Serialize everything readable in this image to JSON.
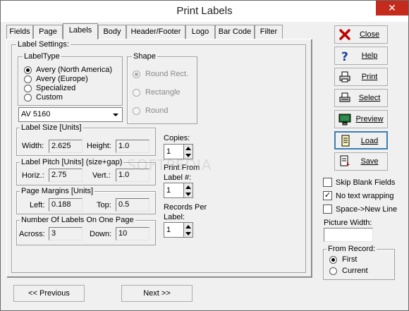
{
  "window": {
    "title": "Print Labels",
    "close_glyph": "✕"
  },
  "tabs": [
    "Fields",
    "Page",
    "Labels",
    "Body",
    "Header/Footer",
    "Logo",
    "Bar Code",
    "Filter"
  ],
  "active_tab": "Labels",
  "label_settings": {
    "legend": "Label Settings:",
    "label_type": {
      "legend": "LabelType",
      "options": [
        "Avery (North America)",
        "Avery (Europe)",
        "Specialized",
        "Custom"
      ],
      "selected": "Avery (North America)"
    },
    "shape": {
      "legend": "Shape",
      "options": [
        "Round Rect.",
        "Rectangle",
        "Round"
      ],
      "selected": "Round Rect."
    },
    "template": "AV 5160"
  },
  "label_size": {
    "legend": "Label Size [Units]",
    "width_label": "Width:",
    "width": "2.625",
    "height_label": "Height:",
    "height": "1.0"
  },
  "label_pitch": {
    "legend": "Label Pitch [Units] (size+gap)",
    "horiz_label": "Horiz.:",
    "horiz": "2.75",
    "vert_label": "Vert.:",
    "vert": "1.0"
  },
  "page_margins": {
    "legend": "Page Margins [Units]",
    "left_label": "Left:",
    "left": "0.188",
    "top_label": "Top:",
    "top": "0.5"
  },
  "labels_on_page": {
    "legend": "Number Of Labels On One Page",
    "across_label": "Across:",
    "across": "3",
    "down_label": "Down:",
    "down": "10"
  },
  "copies": {
    "label": "Copies:",
    "value": "1"
  },
  "print_from": {
    "label_line1": "Print From",
    "label_line2": "Label #:",
    "value": "1"
  },
  "records_per": {
    "label_line1": "Records Per",
    "label_line2": "Label:",
    "value": "1"
  },
  "side_buttons": {
    "close": "Close",
    "help": "Help",
    "print": "Print",
    "select": "Select",
    "preview": "Preview",
    "load": "Load",
    "save": "Save"
  },
  "options": {
    "skip_blank": {
      "label": "Skip Blank Fields",
      "checked": false
    },
    "no_wrap": {
      "label": "No text wrapping",
      "checked": true
    },
    "space_newline": {
      "label": "Space->New Line",
      "checked": false
    }
  },
  "picture_width": {
    "label": "Picture Width:",
    "value": ""
  },
  "from_record": {
    "legend": "From Record:",
    "options": [
      "First",
      "Current"
    ],
    "selected": "First"
  },
  "nav": {
    "previous": "<< Previous",
    "next": "Next >>"
  },
  "watermark": "SOFTPEDIA",
  "colors": {
    "close_red": "#c42b1c",
    "focus_blue": "#3c7fb1"
  }
}
